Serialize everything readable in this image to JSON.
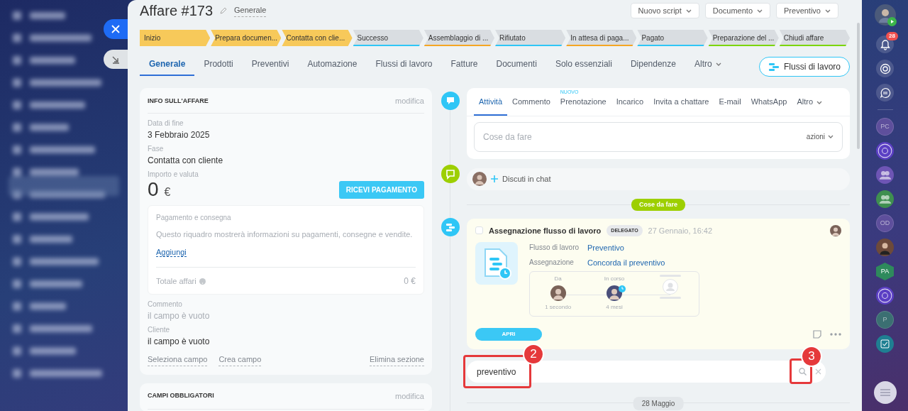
{
  "header": {
    "title": "Affare #173",
    "category": "Generale",
    "buttons": [
      "Nuovo script",
      "Documento",
      "Preventivo"
    ]
  },
  "stages": [
    {
      "label": "Inizio",
      "reached": true,
      "color": "#f7c95a"
    },
    {
      "label": "Prepara documen...",
      "reached": true,
      "color": "#f7c95a"
    },
    {
      "label": "Contatta con clie...",
      "reached": true,
      "color": "#f7c95a"
    },
    {
      "label": "Successo",
      "reached": false,
      "color": "#2fc6f6"
    },
    {
      "label": "Assemblaggio di ...",
      "reached": false,
      "color": "#f5a623"
    },
    {
      "label": "Rifiutato",
      "reached": false,
      "color": "#2fc6f6"
    },
    {
      "label": "In attesa di paga...",
      "reached": false,
      "color": "#f5a623"
    },
    {
      "label": "Pagato",
      "reached": false,
      "color": "#2fc6f6"
    },
    {
      "label": "Preparazione del ...",
      "reached": false,
      "color": "#7bd500"
    },
    {
      "label": "Chiudi affare",
      "reached": false,
      "color": "#7bd500"
    }
  ],
  "tabs": [
    {
      "label": "Generale",
      "selected": true,
      "dropdown": false
    },
    {
      "label": "Prodotti",
      "selected": false,
      "dropdown": false
    },
    {
      "label": "Preventivi",
      "selected": false,
      "dropdown": false
    },
    {
      "label": "Automazione",
      "selected": false,
      "dropdown": false
    },
    {
      "label": "Flussi di lavoro",
      "selected": false,
      "dropdown": false
    },
    {
      "label": "Fatture",
      "selected": false,
      "dropdown": false
    },
    {
      "label": "Documenti",
      "selected": false,
      "dropdown": false
    },
    {
      "label": "Solo essenziali",
      "selected": false,
      "dropdown": false
    },
    {
      "label": "Dipendenze",
      "selected": false,
      "dropdown": false
    },
    {
      "label": "Altro",
      "selected": false,
      "dropdown": true
    }
  ],
  "workflow_button": "Flussi di lavoro",
  "deal_info": {
    "title": "INFO SULL'AFFARE",
    "edit": "modifica",
    "fields": [
      {
        "label": "Data di fine",
        "value": "3 Febbraio 2025"
      },
      {
        "label": "Fase",
        "value": "Contatta con cliente"
      }
    ],
    "amount": {
      "label": "Importo e valuta",
      "value": "0",
      "currency": "€"
    },
    "pay_button": "RICEVI PAGAMENTO",
    "payment_box": {
      "title": "Pagamento e consegna",
      "text": "Questo riquadro mostrerà informazioni su pagamenti, consegne e vendite.",
      "link": "Aggiungi",
      "total_label": "Totale affari",
      "total_value": "0 €"
    },
    "more_fields": [
      {
        "label": "Commento",
        "value": "il campo è vuoto",
        "empty": true
      },
      {
        "label": "Cliente",
        "value": "il campo è vuoto",
        "empty": false
      }
    ],
    "links": [
      "Seleziona campo",
      "Crea campo"
    ],
    "delete_link": "Elimina sezione"
  },
  "required_card": {
    "title": "CAMPI OBBLIGATORI",
    "edit": "modifica"
  },
  "activity": {
    "tabs": [
      {
        "label": "Attività",
        "selected": true
      },
      {
        "label": "Commento",
        "selected": false
      },
      {
        "label": "Prenotazione",
        "selected": false,
        "badge": "NUOVO"
      },
      {
        "label": "Incarico",
        "selected": false
      },
      {
        "label": "Invita a chattare",
        "selected": false
      },
      {
        "label": "E-mail",
        "selected": false
      },
      {
        "label": "WhatsApp",
        "selected": false
      },
      {
        "label": "Altro",
        "selected": false,
        "dropdown": true
      }
    ],
    "placeholder": "Cose da fare",
    "actions": "azioni"
  },
  "chat": {
    "label": "Discuti in chat"
  },
  "section_label": "Cose da fare",
  "task": {
    "checked": false,
    "title": "Assegnazione flusso di lavoro",
    "status": "DELEGATO",
    "time": "27 Gennaio, 16:42",
    "rows": [
      {
        "label": "Flusso di lavoro",
        "value": "Preventivo"
      },
      {
        "label": "Assegnazione",
        "value": "Concorda il preventivo"
      }
    ],
    "steps": [
      {
        "kind": "person",
        "label": "Da",
        "time": "1 secondo"
      },
      {
        "kind": "pending",
        "label": "In corso",
        "time": "4 mesi"
      },
      {
        "kind": "empty"
      }
    ],
    "button": "APRI"
  },
  "search": {
    "value": "preventivo"
  },
  "date_label": "28 Maggio",
  "annotations": [
    {
      "label": "2"
    },
    {
      "label": "3"
    }
  ],
  "right_bar": {
    "notifications": "28",
    "items": [
      {
        "kind": "initials",
        "text": "PC",
        "color": "#5e4f9c"
      },
      {
        "kind": "target",
        "color": "#5b3fc4"
      },
      {
        "kind": "group",
        "color": "#6e55b5"
      },
      {
        "kind": "group",
        "color": "#3f8f50"
      },
      {
        "kind": "initials",
        "text": "OD",
        "color": "#5e4f9c"
      },
      {
        "kind": "avatar",
        "color": "#6d4a3a"
      },
      {
        "kind": "hexagon",
        "text": "PA",
        "color": "#2e8a5c"
      },
      {
        "kind": "target",
        "color": "#5b3fc4"
      },
      {
        "kind": "initials",
        "text": "P",
        "color": "#3b6f72"
      },
      {
        "kind": "task",
        "color": "#1f7f92"
      }
    ]
  }
}
